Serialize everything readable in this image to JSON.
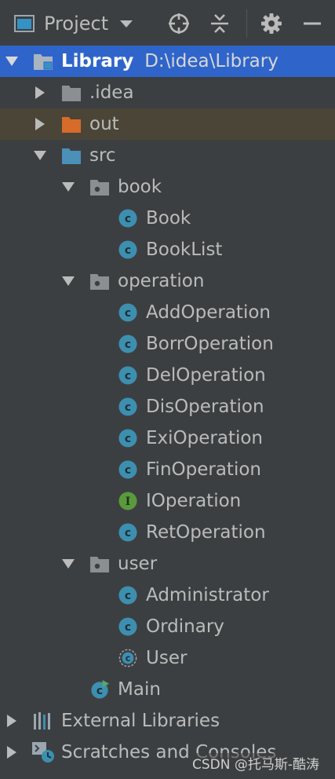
{
  "toolbar": {
    "title": "Project",
    "icons": [
      "project-view-icon",
      "dropdown-caret-icon",
      "locate-icon",
      "collapse-all-icon",
      "settings-icon",
      "hide-icon"
    ]
  },
  "tree": {
    "root": {
      "name": "Library",
      "path": "D:\\idea\\Library"
    },
    "idea": ".idea",
    "out": "out",
    "src": "src",
    "book": "book",
    "book_items": [
      "Book",
      "BookList"
    ],
    "operation": "operation",
    "operation_items": [
      "AddOperation",
      "BorrOperation",
      "DelOperation",
      "DisOperation",
      "ExiOperation",
      "FinOperation",
      "IOperation",
      "RetOperation"
    ],
    "user": "user",
    "user_items": [
      "Administrator",
      "Ordinary",
      "User"
    ],
    "main": "Main",
    "external_libraries": "External Libraries",
    "scratches": "Scratches and Consoles"
  },
  "watermark": "CSDN @托马斯-酷涛",
  "colors": {
    "background": "#3c3f41",
    "selected": "#2f65ca",
    "excluded_bg": "#4a4537",
    "class_icon": "#3d8fb0",
    "interface_icon": "#5a9a3c",
    "folder_src": "#4a90b8",
    "folder_out": "#d76b2a",
    "folder_plain": "#8c8f91"
  }
}
